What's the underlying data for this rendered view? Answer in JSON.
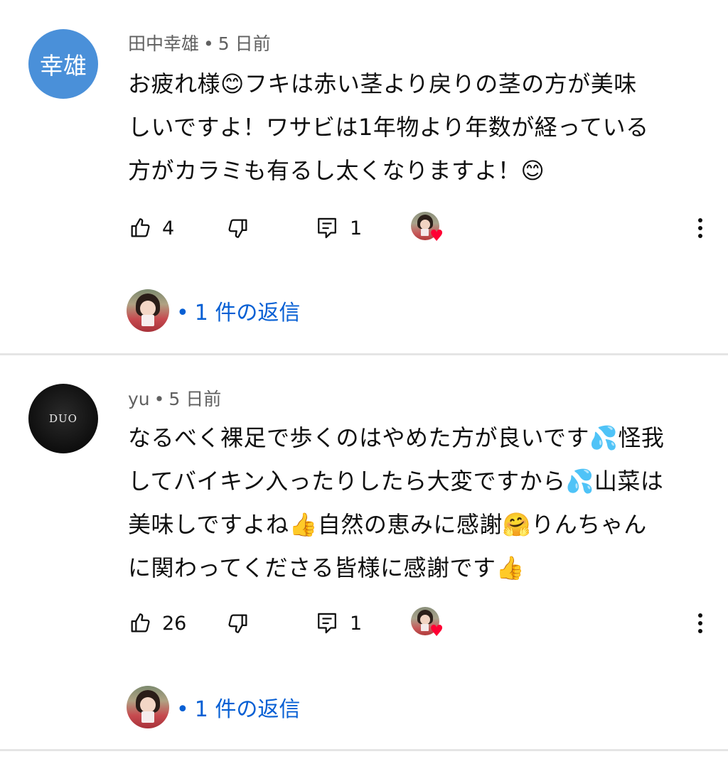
{
  "comments": [
    {
      "author": "田中幸雄",
      "avatar_text": "幸雄",
      "avatar_color": "#4a90d9",
      "time": "5 日前",
      "lines": [
        "お疲れ様😊フキは赤い茎より戻りの茎の方が美味",
        "しいですよ！ワサビは1年物より年数が経っている",
        "方がカラミも有るし太くなりますよ！😊"
      ],
      "likes": "4",
      "reply_count": "1",
      "creator_heart": true,
      "replies_label": "1 件の返信"
    },
    {
      "author": "yu",
      "avatar_text": "DUO",
      "avatar_color": "#111111",
      "time": "5 日前",
      "lines": [
        "なるべく裸足で歩くのはやめた方が良いです💦怪我",
        "してバイキン入ったりしたら大変ですから💦山菜は",
        "美味しですよね👍自然の恵みに感謝🤗りんちゃん",
        "に関わってくださる皆様に感謝です👍"
      ],
      "likes": "26",
      "reply_count": "1",
      "creator_heart": true,
      "replies_label": "1 件の返信"
    }
  ],
  "separator": "•",
  "icons": {
    "like": "thumb-up-icon",
    "dislike": "thumb-down-icon",
    "reply": "comment-icon",
    "more": "more-vert-icon",
    "heart": "heart-icon"
  },
  "colors": {
    "link": "#065fd4",
    "meta": "#606060",
    "heart": "#ff0033"
  }
}
